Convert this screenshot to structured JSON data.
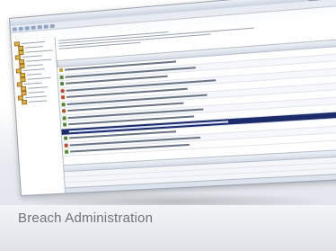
{
  "caption": "Breach Administration",
  "window": {
    "title": "",
    "header": "",
    "tree_nodes": 14,
    "rows": [
      {
        "icon_color": "#c0a030"
      },
      {
        "icon_color": "#4f8a2a"
      },
      {
        "icon_color": "#4f8a2a"
      },
      {
        "icon_color": "#c04a2a"
      },
      {
        "icon_color": "#c04a2a"
      },
      {
        "icon_color": "#4f8a2a"
      },
      {
        "icon_color": "#c04a2a"
      },
      {
        "icon_color": "#4f8a2a"
      },
      {
        "icon_color": "#4f8a2a"
      },
      {
        "icon_color": "#1c2b6a",
        "selected": true
      },
      {
        "icon_color": "#4f8a2a"
      },
      {
        "icon_color": "#c04a2a"
      },
      {
        "icon_color": "#4f8a2a"
      }
    ]
  },
  "colors": {
    "selection": "#1c2b6a",
    "caption_text": "#6f7378"
  }
}
